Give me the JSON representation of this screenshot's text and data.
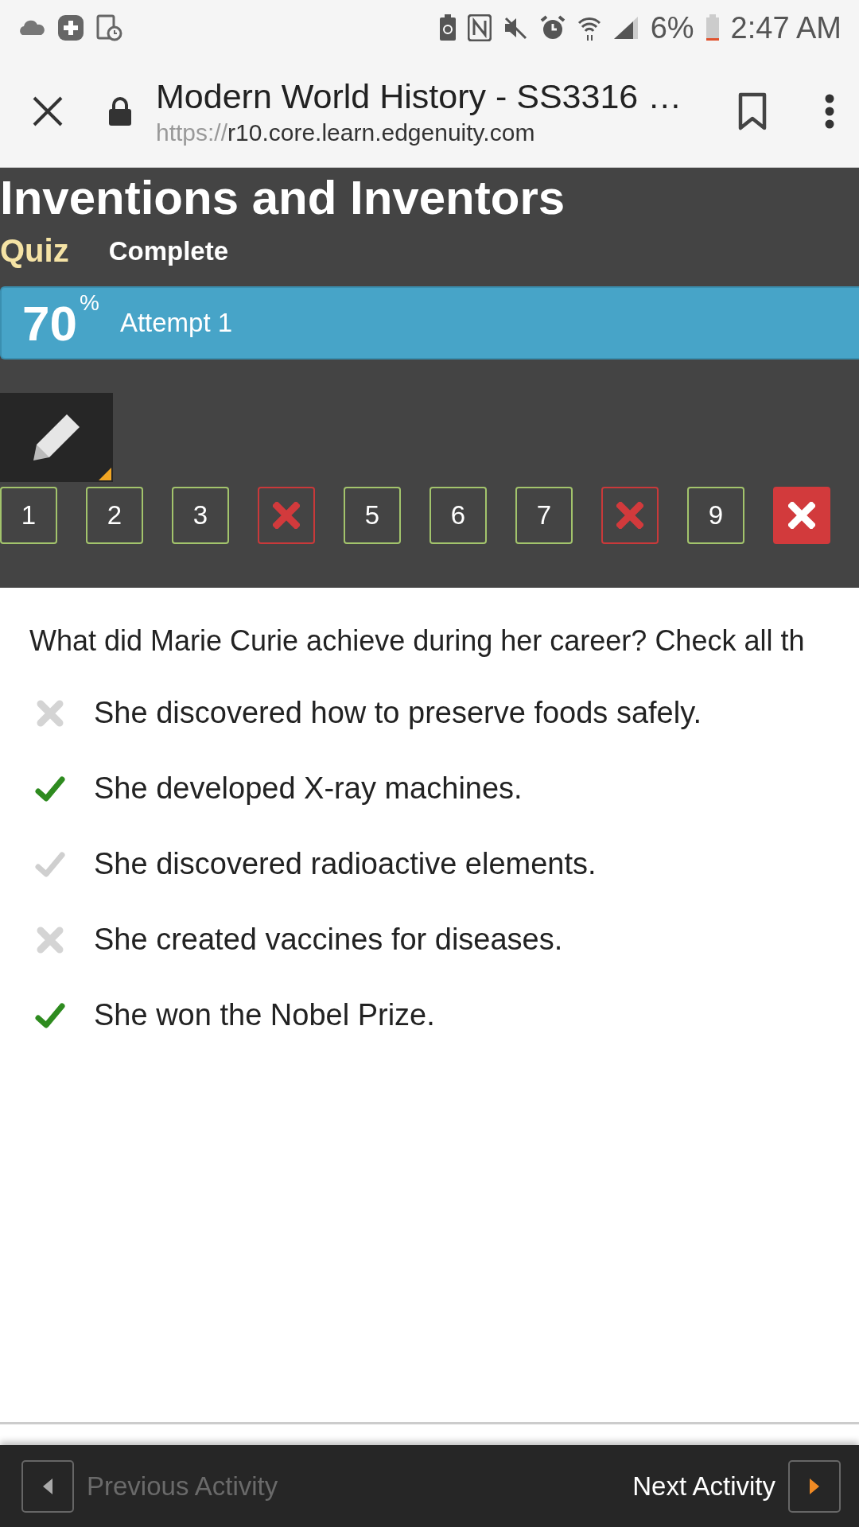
{
  "status_bar": {
    "battery": "6%",
    "time": "2:47 AM"
  },
  "browser": {
    "title": "Modern World History - SS3316 …",
    "url_scheme": "https://",
    "url_host": "r10.core.learn.edgenuity.com"
  },
  "lesson": {
    "title": "Inventions and Inventors",
    "type": "Quiz",
    "status": "Complete"
  },
  "score": {
    "value": "70",
    "unit": "%",
    "attempt": "Attempt 1"
  },
  "questions": [
    {
      "kind": "correct",
      "label": "1",
      "selected": false
    },
    {
      "kind": "correct",
      "label": "2",
      "selected": false
    },
    {
      "kind": "correct",
      "label": "3",
      "selected": false
    },
    {
      "kind": "incorrect",
      "selected": false
    },
    {
      "kind": "correct",
      "label": "5",
      "selected": false
    },
    {
      "kind": "correct",
      "label": "6",
      "selected": false
    },
    {
      "kind": "correct",
      "label": "7",
      "selected": false
    },
    {
      "kind": "incorrect",
      "selected": false
    },
    {
      "kind": "correct",
      "label": "9",
      "selected": false
    },
    {
      "kind": "incorrect",
      "selected": true
    }
  ],
  "question": "What did Marie Curie achieve during her career? Check all th",
  "answers": [
    {
      "kind": "cross",
      "selected": false,
      "text": "She discovered how to preserve foods safely."
    },
    {
      "kind": "check",
      "selected": true,
      "text": "She developed X-ray machines."
    },
    {
      "kind": "check",
      "selected": false,
      "text": "She discovered radioactive elements."
    },
    {
      "kind": "cross",
      "selected": false,
      "text": "She created vaccines for diseases."
    },
    {
      "kind": "check",
      "selected": true,
      "text": "She won the Nobel Prize."
    }
  ],
  "footer": {
    "previous": {
      "label": "Previous Activity",
      "disabled": true
    },
    "next": {
      "label": "Next Activity",
      "disabled": false
    }
  }
}
